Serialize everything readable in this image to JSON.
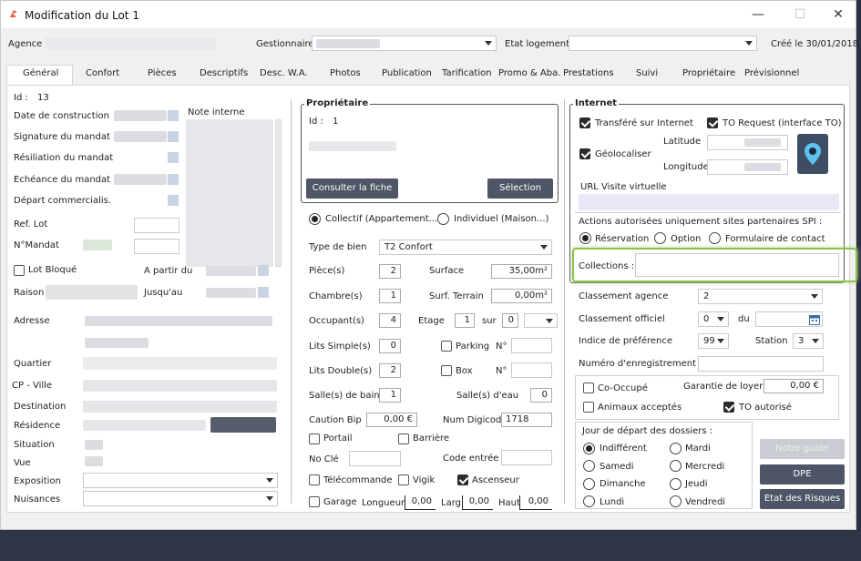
{
  "window": {
    "title": "Modification du Lot 1",
    "minimize": "—",
    "maximize": "☐",
    "close": "✕"
  },
  "header": {
    "agence_label": "Agence",
    "gestionnaire_label": "Gestionnaire",
    "etat_label": "Etat logement",
    "cree": "Créé le 30/01/2018"
  },
  "tabs": [
    "Général",
    "Confort",
    "Pièces",
    "Descriptifs",
    "Desc. W.A.",
    "Photos",
    "Publication",
    "Tarification",
    "Promo & Aba.",
    "Prestations",
    "Suivi",
    "Propriétaire",
    "Prévisionnel"
  ],
  "left": {
    "id_label": "Id :",
    "id_value": "13",
    "date_construction": "Date de construction",
    "signature": "Signature du mandat",
    "resiliation": "Résiliation du mandat",
    "echeance": "Echéance du mandat",
    "depart": "Départ commercialis.",
    "note_interne": "Note interne",
    "ref_lot": "Ref. Lot",
    "mandat": "N°Mandat",
    "lot_bloque": "Lot Bloqué",
    "a_partir": "A partir du",
    "raison": "Raison",
    "jusqu": "Jusqu'au",
    "adresse": "Adresse",
    "quartier": "Quartier",
    "cp_ville": "CP - Ville",
    "destination": "Destination",
    "residence": "Résidence",
    "situation": "Situation",
    "vue": "Vue",
    "exposition": "Exposition",
    "nuisances": "Nuisances"
  },
  "proprio": {
    "title": "Propriétaire",
    "id_label": "Id :",
    "id_value": "1",
    "consulter": "Consulter la fiche",
    "selection": "Sélection"
  },
  "mid": {
    "collectif": "Collectif (Appartement...)",
    "individuel": "Individuel (Maison...)",
    "type_bien_label": "Type de bien",
    "type_bien": "T2 Confort",
    "pieces_label": "Pièce(s)",
    "pieces": "2",
    "surface_label": "Surface",
    "surface": "35,00m²",
    "chambres_label": "Chambre(s)",
    "chambres": "1",
    "surf_terrain_label": "Surf. Terrain",
    "surf_terrain": "0,00m²",
    "occupants_label": "Occupant(s)",
    "occupants": "4",
    "etage_label": "Etage",
    "etage": "1",
    "sur_label": "sur",
    "sur": "0",
    "lits_simple_label": "Lits Simple(s)",
    "lits_simple": "0",
    "parking": "Parking",
    "n1": "N°",
    "lits_double_label": "Lits Double(s)",
    "lits_double": "2",
    "box": "Box",
    "n2": "N°",
    "sdb_label": "Salle(s) de bains",
    "sdb": "1",
    "seau_label": "Salle(s) d'eau",
    "seau": "0",
    "caution_label": "Caution Bip",
    "caution": "0,00 €",
    "digicode_label": "Num Digicode",
    "digicode": "1718",
    "portail": "Portail",
    "barriere": "Barrière",
    "no_cle": "No Clé",
    "code_entree": "Code entrée",
    "telecommande": "Télécommande",
    "vigik": "Vigik",
    "ascenseur": "Ascenseur",
    "garage": "Garage",
    "longueur_label": "Longueur",
    "longueur": "0,00",
    "larg_label": "Larg.",
    "larg": "0,00",
    "haut_label": "Haut.",
    "haut": "0,00"
  },
  "internet": {
    "title": "Internet",
    "transfere": "Transféré sur Internet",
    "to_request": "TO Request (interface TO)",
    "geoloc": "Géolocaliser",
    "latitude": "Latitude",
    "longitude": "Longitude",
    "url_visite": "URL Visite virtuelle",
    "actions": "Actions autorisées uniquement sites partenaires SPI :",
    "reservation": "Réservation",
    "option": "Option",
    "formulaire": "Formulaire de contact",
    "collections": "Collections :"
  },
  "right": {
    "classement_agence_label": "Classement agence",
    "classement_agence": "2",
    "classement_officiel_label": "Classement officiel",
    "classement_officiel": "0",
    "du": "du",
    "indice_label": "Indice de préférence",
    "indice": "99",
    "station_label": "Station",
    "station": "3",
    "numero_enreg": "Numéro d'enregistrement",
    "co_occupe": "Co-Occupé",
    "garantie_label": "Garantie de loyer",
    "garantie": "0,00 €",
    "animaux": "Animaux acceptés",
    "to_autorise": "TO autorisé",
    "jour_depart": "Jour de départ des dossiers :",
    "indifferent": "Indifférent",
    "mardi": "Mardi",
    "samedi": "Samedi",
    "mercredi": "Mercredi",
    "dimanche": "Dimanche",
    "jeudi": "Jeudi",
    "lundi": "Lundi",
    "vendredi": "Vendredi",
    "notre_guide": "Notre guide",
    "dpe": "DPE",
    "etat_risques": "Etat des Risques"
  },
  "colors": {
    "accent_highlight": "#8bc34a",
    "button": "#4d5566",
    "map_button": "#3d4d63"
  }
}
